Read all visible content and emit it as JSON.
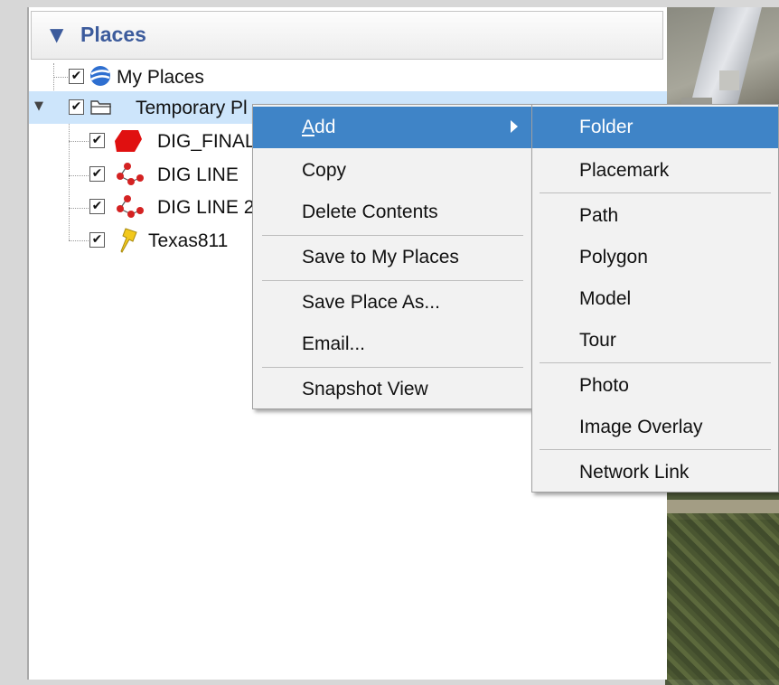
{
  "panel": {
    "title": "Places"
  },
  "tree": {
    "my_places": "My Places",
    "temporary_places": "Temporary Pl",
    "items": [
      {
        "label": "DIG_FINAL",
        "icon": "polygon-icon"
      },
      {
        "label": "DIG LINE",
        "icon": "path-icon"
      },
      {
        "label": "DIG LINE 2",
        "icon": "path-icon"
      },
      {
        "label": "Texas811",
        "icon": "pushpin-icon"
      }
    ],
    "check": "✔"
  },
  "context_menu": {
    "add": {
      "prefix": "",
      "mnemonic": "A",
      "suffix": "dd"
    },
    "copy": "Copy",
    "delete_contents": "Delete Contents",
    "save_to_my_places": "Save to My Places",
    "save_place_as": "Save Place As...",
    "email": "Email...",
    "snapshot_view": "Snapshot View"
  },
  "add_submenu": {
    "folder": "Folder",
    "placemark": "Placemark",
    "path": "Path",
    "polygon": "Polygon",
    "model": "Model",
    "tour": "Tour",
    "photo": "Photo",
    "image_overlay": "Image Overlay",
    "network_link": "Network Link"
  },
  "colors": {
    "header_text": "#3c5b9c",
    "selection": "#cde5fb",
    "menu_highlight": "#3f84c7",
    "polygon_red": "#e01010",
    "path_red": "#d42222",
    "pushpin_yellow": "#f2c81c"
  }
}
